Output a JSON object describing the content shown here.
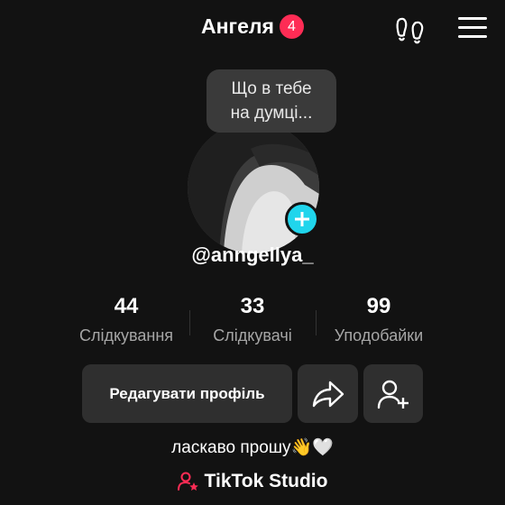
{
  "header": {
    "title": "Ангеля",
    "badge_count": "4"
  },
  "icons": {
    "footprint": "footprint-icon",
    "menu": "menu-icon",
    "share": "share-icon",
    "add_friend": "add-friend-icon",
    "plus": "plus-icon",
    "studio": "tiktok-studio-icon"
  },
  "profile": {
    "bubble_text_line1": "Що в тебе",
    "bubble_text_line2": "на думці...",
    "username": "@anngellya_"
  },
  "stats": [
    {
      "value": "44",
      "label": "Слідкування"
    },
    {
      "value": "33",
      "label": "Слідкувачі"
    },
    {
      "value": "99",
      "label": "Уподобайки"
    }
  ],
  "actions": {
    "edit_profile": "Редагувати профіль"
  },
  "bio": "ласкаво прошу👋🤍",
  "studio_label": "TikTok Studio",
  "colors": {
    "background": "#121212",
    "badge": "#fe2c55",
    "add_button": "#20d5ec",
    "button_bg": "#2f2f2f",
    "studio_icon": "#fe2c55"
  }
}
